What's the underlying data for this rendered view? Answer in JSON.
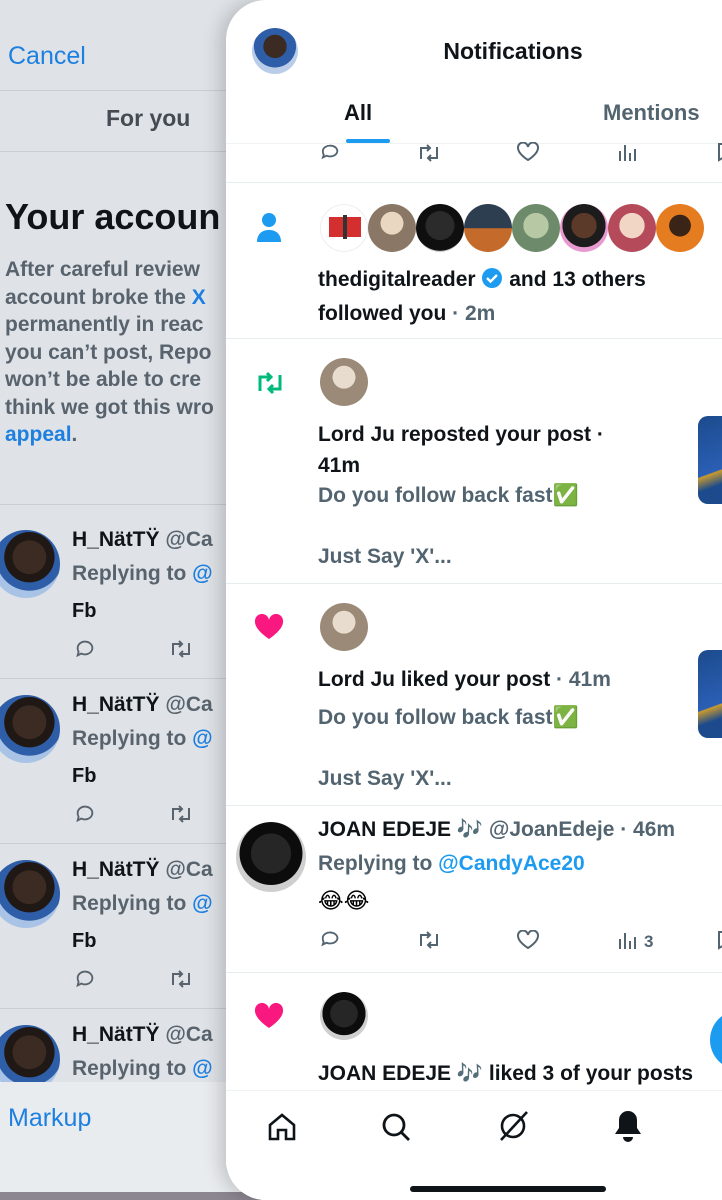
{
  "background_screen": {
    "cancel_label": "Cancel",
    "tab_label": "For you",
    "headline": "Your accoun",
    "body_lines": [
      {
        "text": "After careful review",
        "link": ""
      },
      {
        "text": "account broke the ",
        "link": "X"
      },
      {
        "text": "permanently in reac",
        "link": ""
      },
      {
        "text": "you can’t post, Repo",
        "link": ""
      },
      {
        "text": "won’t be able to cre",
        "link": ""
      },
      {
        "text": "think we got this wro",
        "link": ""
      },
      {
        "text": "",
        "link": "appeal",
        "suffix": "."
      }
    ],
    "rows": [
      {
        "name": "H_NätTŸ",
        "handle": "@Ca",
        "replying_prefix": "Replying to ",
        "replying_link": "@",
        "text": "Fb"
      },
      {
        "name": "H_NätTŸ",
        "handle": "@Ca",
        "replying_prefix": "Replying to ",
        "replying_link": "@",
        "text": "Fb"
      },
      {
        "name": "H_NätTŸ",
        "handle": "@Ca",
        "replying_prefix": "Replying to ",
        "replying_link": "@",
        "text": "Fb"
      },
      {
        "name": "H_NätTŸ",
        "handle": "@Ca",
        "replying_prefix": "Replying to ",
        "replying_link": "@",
        "text": ""
      }
    ],
    "markup_label": "Markup"
  },
  "header": {
    "title": "Notifications"
  },
  "tabs": [
    {
      "label": "All",
      "active": true
    },
    {
      "label": "Mentions",
      "active": false
    }
  ],
  "notifications": [
    {
      "type": "follow",
      "actor": "thedigitalreader",
      "verified": true,
      "rest": " and 13 others",
      "line2": "followed you",
      "time": " · 2m",
      "icon": "person-icon"
    },
    {
      "type": "repost",
      "line1": "Lord Ju reposted your post ·",
      "time": "41m",
      "preview1": "Do you follow back fast✅",
      "preview2": "Just Say 'X'...",
      "icon": "repost-icon"
    },
    {
      "type": "like",
      "line1": "Lord Ju liked your post",
      "time": " · 41m",
      "preview1": "Do you follow back fast✅",
      "preview2": "Just Say 'X'...",
      "icon": "heart-icon"
    },
    {
      "type": "reply",
      "name": "JOAN EDEJE 🎶",
      "handle": " @JoanEdeje",
      "time": " · 46m",
      "replying_prefix": "Replying to ",
      "replying_link": "@CandyAce20",
      "body": "😂😂",
      "views": "3"
    },
    {
      "type": "like",
      "line1": "JOAN EDEJE 🎶 liked 3 of your posts",
      "icon": "heart-icon"
    }
  ],
  "colors": {
    "accent": "#1d9bf0",
    "repost": "#00ba7c",
    "like": "#f91880",
    "text": "#0f1419",
    "muted": "#536471"
  },
  "bottom_nav": [
    "home-icon",
    "search-icon",
    "grok-icon",
    "bell-icon"
  ]
}
